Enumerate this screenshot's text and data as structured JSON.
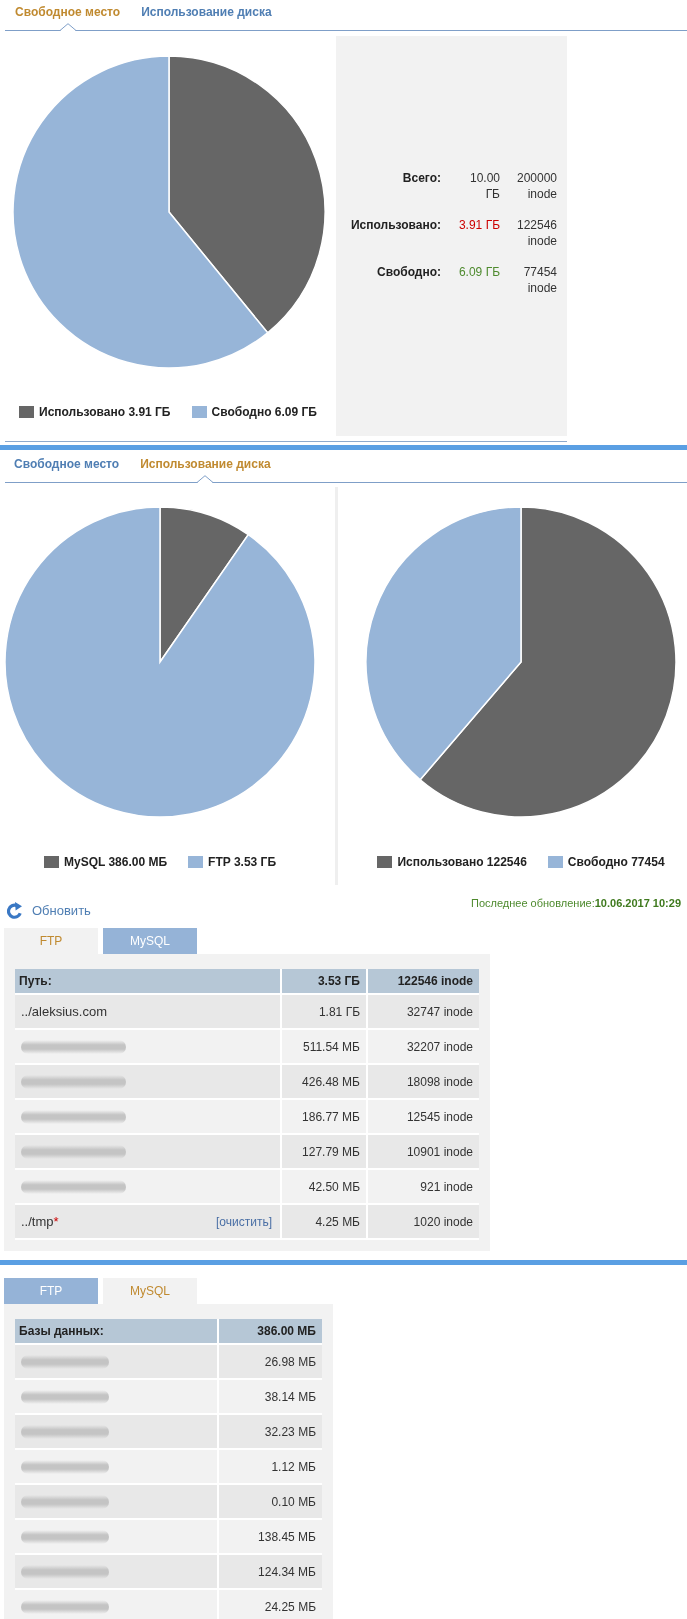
{
  "free_space": {
    "tabs": [
      {
        "label": "Свободное место",
        "selected": true
      },
      {
        "label": "Использование диска",
        "selected": false
      }
    ],
    "chart_data": {
      "type": "pie",
      "categories": [
        "Использовано 3.91 ГБ",
        "Свободно 6.09 ГБ"
      ],
      "values": [
        3.91,
        6.09
      ],
      "colors": [
        "#666666",
        "#97b5d8"
      ]
    },
    "summary": [
      {
        "label": "Всего:",
        "size": "10.00 ГБ",
        "inodes": "200000 inode",
        "color": "#333333"
      },
      {
        "label": "Использовано:",
        "size": "3.91 ГБ",
        "inodes": "122546 inode",
        "color": "#cc0000"
      },
      {
        "label": "Свободно:",
        "size": "6.09 ГБ",
        "inodes": "77454 inode",
        "color": "#4e8a2e"
      }
    ]
  },
  "disk_usage": {
    "tabs": [
      {
        "label": "Свободное место",
        "selected": false
      },
      {
        "label": "Использование диска",
        "selected": true
      }
    ],
    "charts": [
      {
        "chart_data": {
          "type": "pie",
          "categories": [
            "MySQL 386.00 МБ",
            "FTP 3.53 ГБ"
          ],
          "values": [
            386,
            3614.72
          ],
          "colors": [
            "#666666",
            "#97b5d8"
          ]
        }
      },
      {
        "chart_data": {
          "type": "pie",
          "categories": [
            "Использовано 122546",
            "Свободно 77454"
          ],
          "values": [
            122546,
            77454
          ],
          "colors": [
            "#666666",
            "#97b5d8"
          ]
        }
      }
    ]
  },
  "refresh": {
    "label": "Обновить"
  },
  "last_update": {
    "label": "Последнее обновление:",
    "value": "10.06.2017 10:29"
  },
  "ftp": {
    "tabs": [
      {
        "label": "FTP",
        "selected": true
      },
      {
        "label": "MySQL",
        "selected": false
      }
    ],
    "table": {
      "columns": [
        "Путь:",
        "3.53 ГБ",
        "122546 inode"
      ],
      "rows": [
        {
          "kind": "path",
          "path": "../aleksius.com",
          "size": "1.81 ГБ",
          "inodes": "32747 inode"
        },
        {
          "kind": "blurred",
          "size": "511.54 МБ",
          "inodes": "32207 inode"
        },
        {
          "kind": "blurred",
          "size": "426.48 МБ",
          "inodes": "18098 inode"
        },
        {
          "kind": "blurred",
          "size": "186.77 МБ",
          "inodes": "12545 inode"
        },
        {
          "kind": "blurred",
          "size": "127.79 МБ",
          "inodes": "10901 inode"
        },
        {
          "kind": "blurred",
          "size": "42.50 МБ",
          "inodes": "921 inode"
        },
        {
          "kind": "path",
          "path": "../tmp",
          "marker": "*",
          "action": "[очистить]",
          "size": "4.25 МБ",
          "inodes": "1020 inode"
        }
      ]
    }
  },
  "mysql": {
    "tabs": [
      {
        "label": "FTP",
        "selected": false
      },
      {
        "label": "MySQL",
        "selected": true
      }
    ],
    "table": {
      "columns": [
        "Базы данных:",
        "386.00 МБ"
      ],
      "rows": [
        {
          "kind": "blurred",
          "size": "26.98 МБ"
        },
        {
          "kind": "blurred",
          "size": "38.14 МБ"
        },
        {
          "kind": "blurred",
          "size": "32.23 МБ"
        },
        {
          "kind": "blurred",
          "size": "1.12 МБ"
        },
        {
          "kind": "blurred",
          "size": "0.10 МБ"
        },
        {
          "kind": "blurred",
          "size": "138.45 МБ"
        },
        {
          "kind": "blurred",
          "size": "124.34 МБ"
        },
        {
          "kind": "blurred",
          "size": "24.25 МБ"
        }
      ]
    }
  }
}
